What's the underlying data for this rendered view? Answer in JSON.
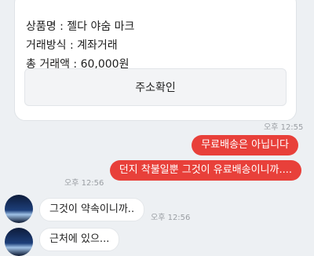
{
  "card": {
    "product_line": "상품명 : 젤다 야숨 마크",
    "method_line": "거래방식 : 계좌거래",
    "total_line": "총 거래액 : 60,000원",
    "confirm_button": "주소확인"
  },
  "messages": {
    "time_1": "오후 12:55",
    "out_1": "무료배송은 아닙니다",
    "time_2": "오후 12:56",
    "out_2": "던지 착불일뿐 그것이 유료배송이니까....",
    "in_1": "그것이 약속이니까..",
    "time_3": "오후 12:56",
    "in_2_partial": "근처에 있으..."
  },
  "colors": {
    "background": "#edf0f3",
    "outgoing_bubble": "#e8403a",
    "incoming_bubble": "#ffffff"
  },
  "icons": {
    "avatar": "profile-avatar"
  }
}
